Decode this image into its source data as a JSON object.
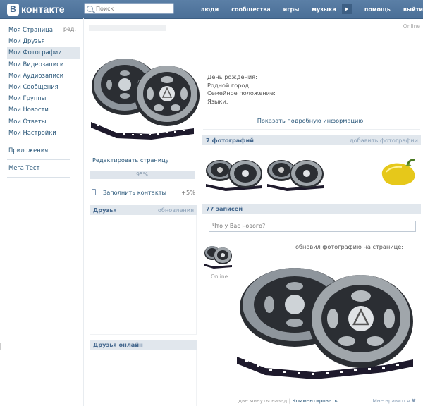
{
  "header": {
    "logo_letter": "В",
    "logo_text": "контакте",
    "search_placeholder": "Поиск",
    "nav": [
      "люди",
      "сообщества",
      "игры",
      "музыка",
      "помощь",
      "выйти"
    ]
  },
  "leftnav": {
    "edit_label": "ред.",
    "items": [
      {
        "label": "Моя Страница"
      },
      {
        "label": "Мои Друзья"
      },
      {
        "label": "Мои Фотографии",
        "active": true
      },
      {
        "label": "Мои Видеозаписи"
      },
      {
        "label": "Мои Аудиозаписи"
      },
      {
        "label": "Мои Сообщения"
      },
      {
        "label": "Мои Группы"
      },
      {
        "label": "Мои Новости"
      },
      {
        "label": "Мои Ответы"
      },
      {
        "label": "Мои Настройки"
      }
    ],
    "apps_label": "Приложения",
    "mega_label": "Мега Тест"
  },
  "profile": {
    "online": "Online",
    "edit_page": "Редактировать страницу",
    "progress_label": "95%",
    "progress_fraction": 0.95,
    "fill_contacts": "Заполнить контакты",
    "fill_bonus": "+5%",
    "friends_title": "Друзья",
    "friends_link": "обновления",
    "friends_online_title": "Друзья онлайн"
  },
  "info": {
    "birthday": "День рождения:",
    "hometown": "Родной город:",
    "family": "Семейное положение:",
    "languages": "Языки:",
    "show_more": "Показать подробную информацию"
  },
  "photos": {
    "title": "7 фотографий",
    "add_link": "добавить фотографии"
  },
  "wall": {
    "title": "77 записей",
    "input_placeholder": "Что у Вас нового?",
    "post_text": "обновил фотографию на странице:",
    "post_online": "Online",
    "post_time": "две минуты назад",
    "post_comment": "Комментировать",
    "post_like": "Мне нравится"
  },
  "icons": {
    "search": "search-icon",
    "play": "play-icon",
    "phone": "phone-icon",
    "heart": "heart-icon"
  },
  "colors": {
    "header_blue": "#4a6f97",
    "link_blue": "#2b587a",
    "block_head_bg": "#e1e7ed"
  }
}
